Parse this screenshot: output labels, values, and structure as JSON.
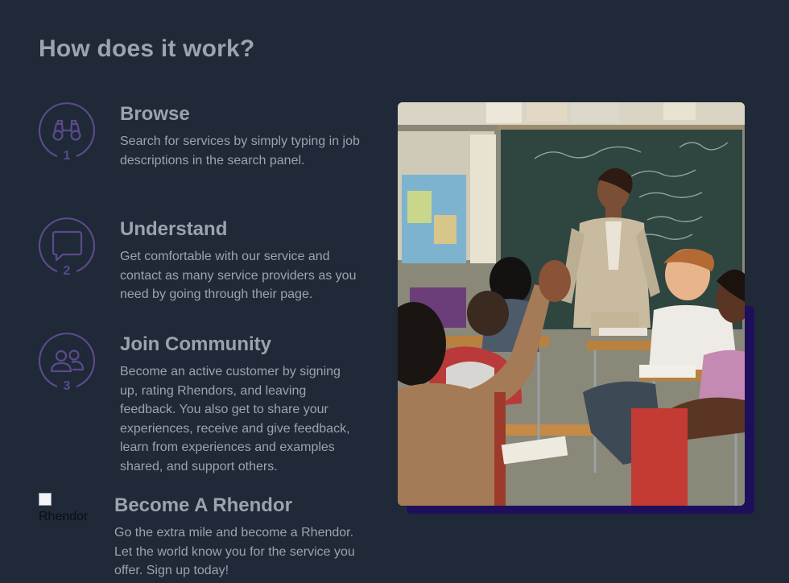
{
  "section": {
    "title": "How does it work?"
  },
  "steps": [
    {
      "number": "1",
      "icon": "binoculars-icon",
      "title": "Browse",
      "description": "Search for services by simply typing in job descriptions in the search panel."
    },
    {
      "number": "2",
      "icon": "chat-bubble-icon",
      "title": "Understand",
      "description": "Get comfortable with our service and contact as many service providers as you need by going through their page."
    },
    {
      "number": "3",
      "icon": "users-icon",
      "title": "Join Community",
      "description": "Become an active customer by signing up, rating Rhendors, and leaving feedback. You also get to share your experiences, receive and give feedback, learn from experiences and examples shared, and support others."
    }
  ],
  "rhendor": {
    "image_alt": "Rhendor",
    "title": "Become A Rhendor",
    "description": "Go the extra mile and become a Rhendor. Let the world know you for the service you offer. Sign up today!"
  },
  "colors": {
    "background": "#1f2937",
    "text": "#9ca3af",
    "icon_accent": "#5b4a8b",
    "photo_shadow": "#1e0f5c"
  }
}
